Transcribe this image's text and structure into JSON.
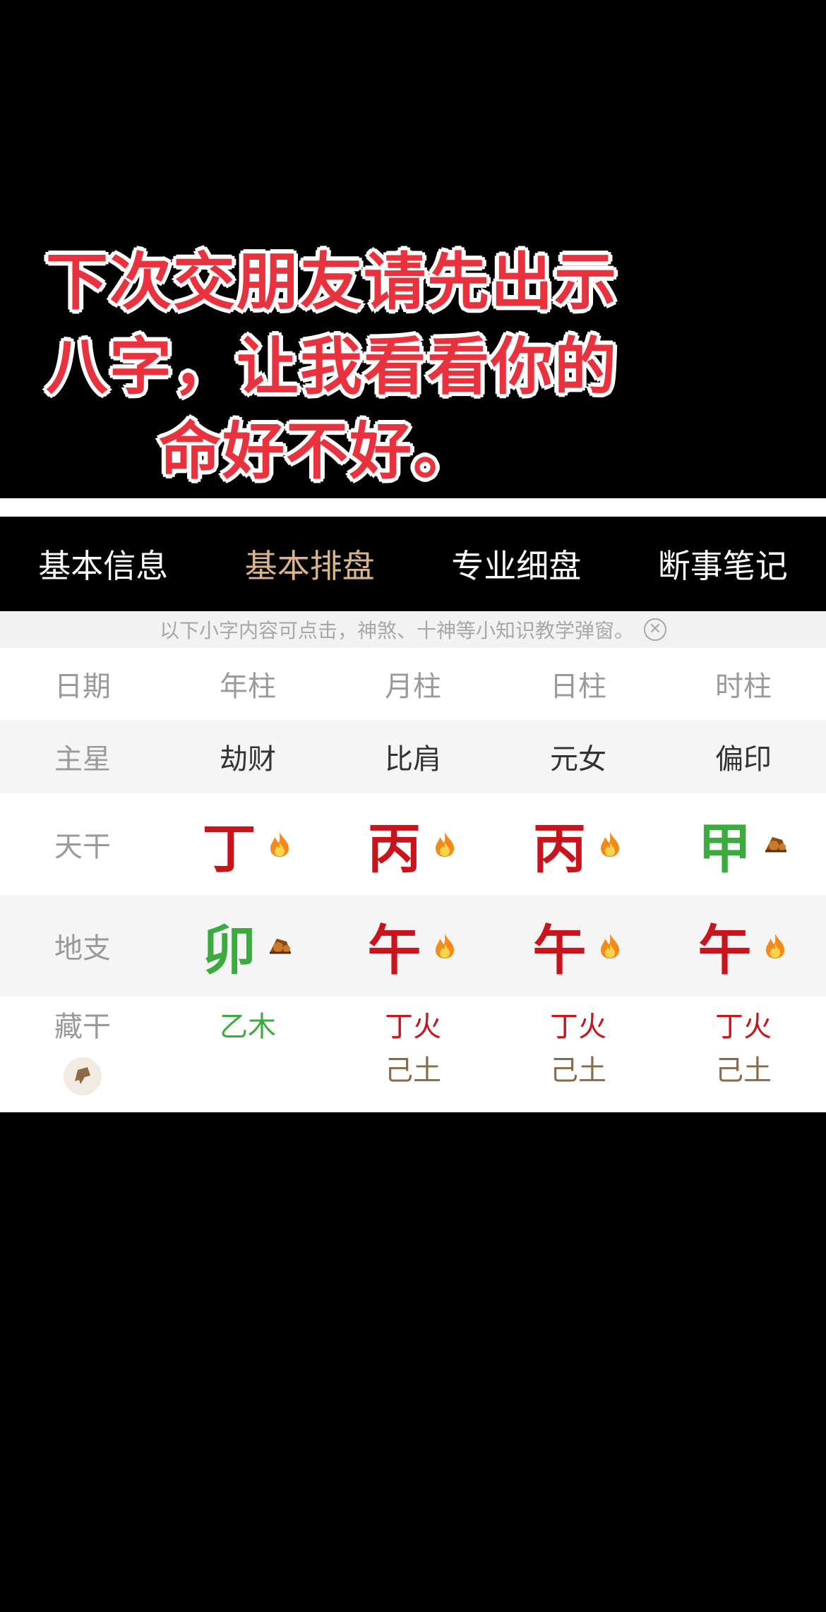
{
  "caption": {
    "lines": [
      "下次交朋友请先出示",
      "八字，让我看看你的",
      "命好不好。"
    ]
  },
  "tabs": [
    {
      "label": "基本信息",
      "active": false
    },
    {
      "label": "基本排盘",
      "active": true
    },
    {
      "label": "专业细盘",
      "active": false
    },
    {
      "label": "断事笔记",
      "active": false
    }
  ],
  "notice": {
    "text": "以下小字内容可点击，神煞、十神等小知识教学弹窗。",
    "close_icon": "close-circle-icon"
  },
  "chart": {
    "headers": [
      "日期",
      "年柱",
      "月柱",
      "日柱",
      "时柱"
    ],
    "main_star": {
      "label": "主星",
      "values": [
        "劫财",
        "比肩",
        "元女",
        "偏印"
      ]
    },
    "heavenly_stem": {
      "label": "天干",
      "values": [
        {
          "char": "丁",
          "element": "fire"
        },
        {
          "char": "丙",
          "element": "fire"
        },
        {
          "char": "丙",
          "element": "fire"
        },
        {
          "char": "甲",
          "element": "wood"
        }
      ]
    },
    "earthly_branch": {
      "label": "地支",
      "values": [
        {
          "char": "卯",
          "element": "wood"
        },
        {
          "char": "午",
          "element": "fire"
        },
        {
          "char": "午",
          "element": "fire"
        },
        {
          "char": "午",
          "element": "fire"
        }
      ]
    },
    "hidden_stems": {
      "label": "藏干",
      "values": [
        [
          "乙木"
        ],
        [
          "丁火",
          "己土"
        ],
        [
          "丁火",
          "己土"
        ],
        [
          "丁火",
          "己土"
        ]
      ]
    }
  },
  "colors": {
    "fire": "#c8141c",
    "wood": "#3bab3f",
    "earth": "#8a6b45",
    "accent_tab": "#d9b48d"
  }
}
